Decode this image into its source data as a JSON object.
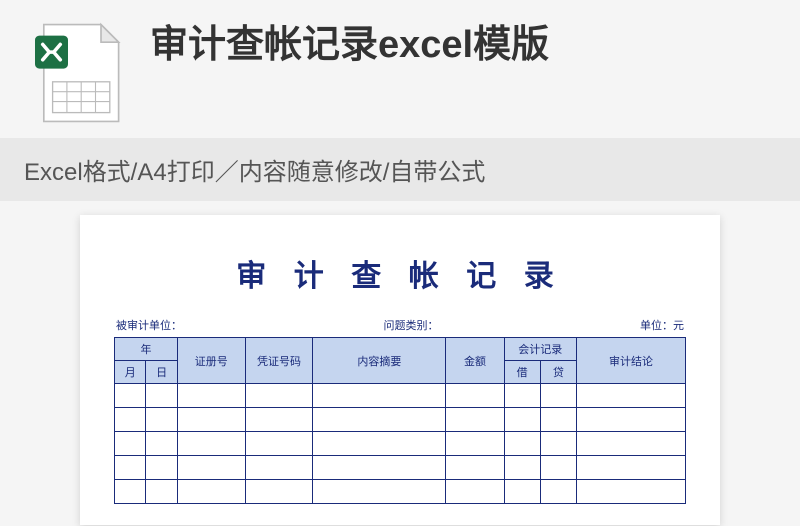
{
  "header": {
    "title": "审计查帐记录excel模版",
    "subtitle": "Excel格式/A4打印／内容随意修改/自带公式"
  },
  "document": {
    "title": "审 计 查 帐 记 录",
    "meta": {
      "audited_unit_label": "被审计单位：",
      "issue_type_label": "问题类别：",
      "unit_label": "单位：元"
    },
    "table_headers": {
      "year": "年",
      "month": "月",
      "day": "日",
      "voucher_no": "证册号",
      "voucher_code": "凭证号码",
      "summary": "内容摘要",
      "amount": "金额",
      "accounting_record": "会计记录",
      "debit": "借",
      "credit": "贷",
      "conclusion": "审计结论"
    }
  }
}
